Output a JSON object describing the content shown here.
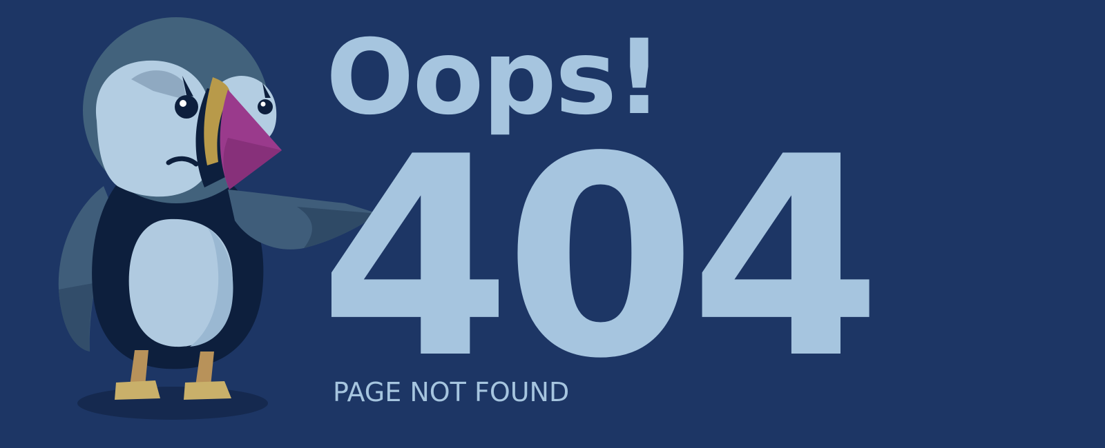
{
  "page": {
    "headline": "Oops!",
    "error_code": "404",
    "message": "PAGE NOT FOUND"
  },
  "colors": {
    "background": "#1d3665",
    "text": "#a6c5df",
    "mascot_head": "#42627c",
    "mascot_face": "#b3cde2",
    "mascot_body_dark": "#0d1f3d",
    "mascot_beak": "#9a3a8c",
    "mascot_beak_stripe": "#b89a4a",
    "mascot_feet": "#b8925a"
  },
  "illustration": {
    "name": "puffin-mascot"
  }
}
